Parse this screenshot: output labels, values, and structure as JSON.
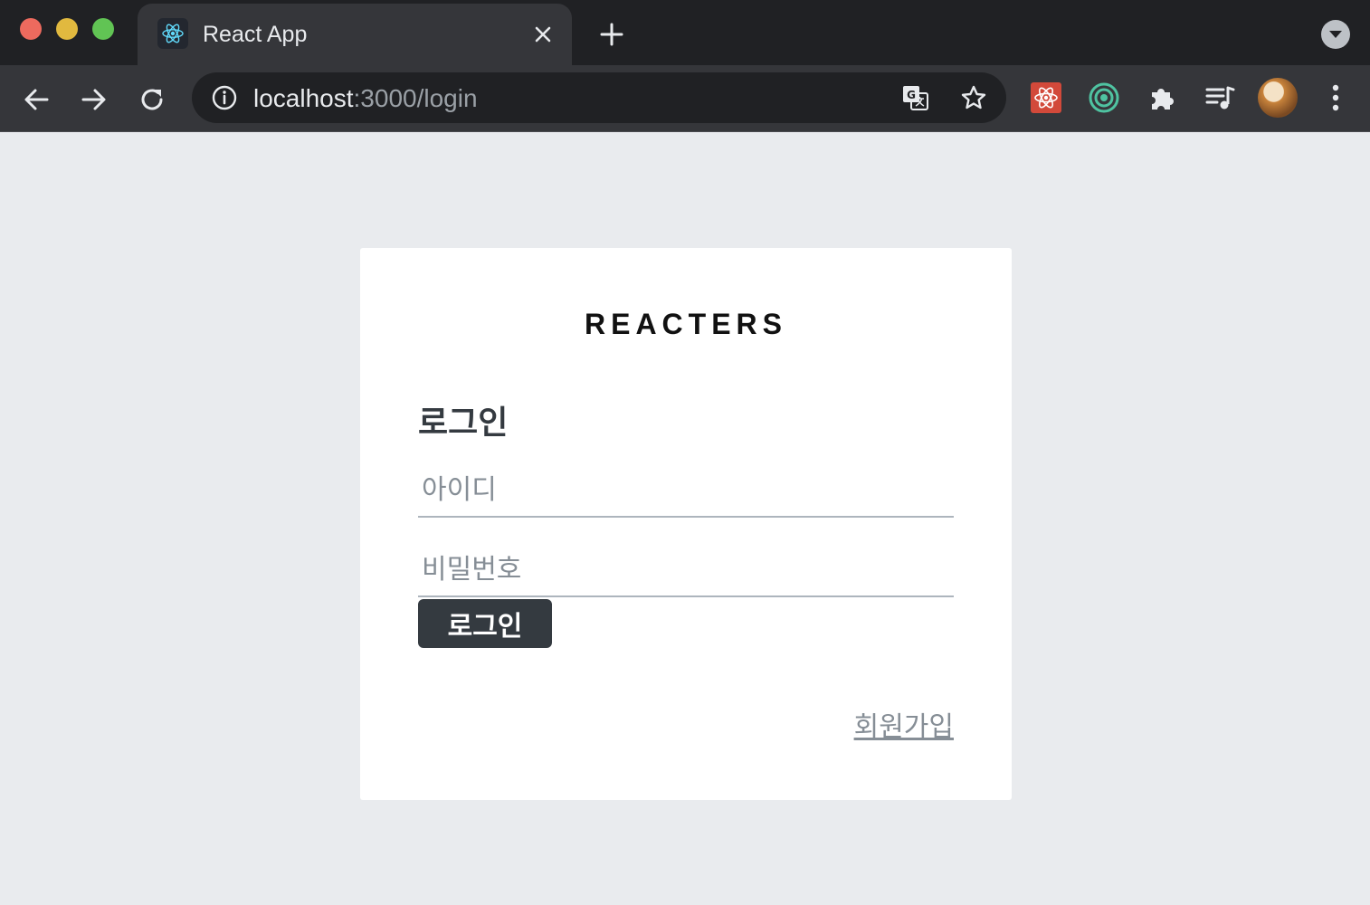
{
  "browser": {
    "tab": {
      "title": "React App",
      "favicon": "react-logo-icon"
    },
    "address_bar": {
      "host": "localhost",
      "rest": ":3000/login"
    },
    "icons": {
      "back": "arrow-left-icon",
      "forward": "arrow-right-icon",
      "reload": "reload-icon",
      "site_info": "info-icon",
      "translate": "translate-icon",
      "bookmark": "star-icon",
      "extensions": "puzzle-icon",
      "media": "playlist-icon",
      "menu": "kebab-menu-icon"
    },
    "colors": {
      "close": "#ed6a5e",
      "minimize": "#e1b93f",
      "maximize": "#61c454"
    }
  },
  "page": {
    "logo": "REACTERS",
    "form_title": "로그인",
    "username_placeholder": "아이디",
    "password_placeholder": "비밀번호",
    "login_button": "로그인",
    "signup_link": "회원가입",
    "colors": {
      "background": "#e9ebee",
      "button": "#343a40",
      "link": "#868e96"
    }
  }
}
